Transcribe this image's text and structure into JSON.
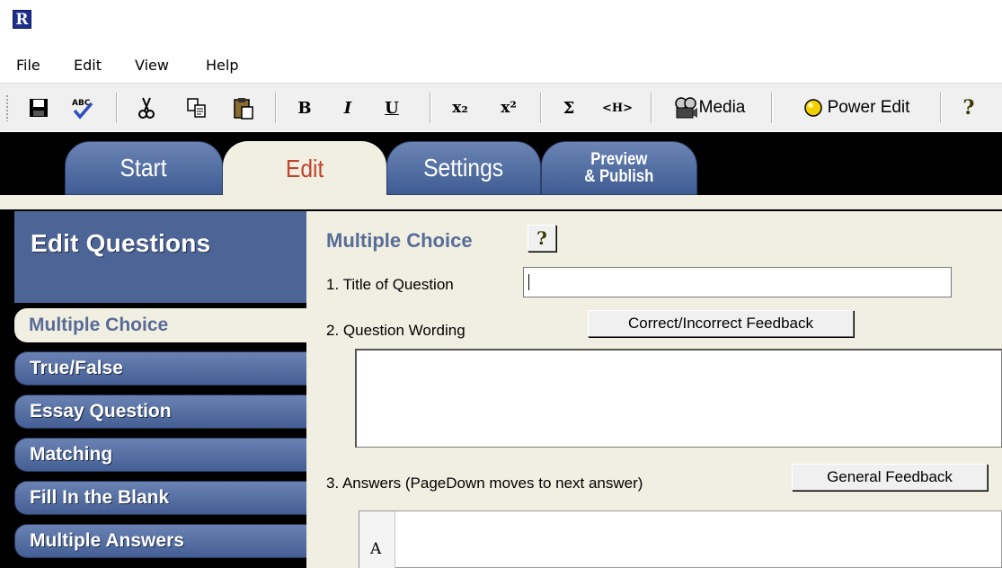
{
  "app": {
    "logo_letter": "R"
  },
  "menu": {
    "items": [
      "File",
      "Edit",
      "View",
      "Help"
    ]
  },
  "toolbar": {
    "bold": "B",
    "italic": "I",
    "underline": "U",
    "subscript": "x₂",
    "superscript": "x²",
    "sigma": "Σ",
    "html": "<H>",
    "media_label": "Media",
    "power_edit_label": "Power Edit",
    "help": "?"
  },
  "tabs": [
    {
      "label": "Start",
      "active": false
    },
    {
      "label": "Edit",
      "active": true
    },
    {
      "label": "Settings",
      "active": false
    },
    {
      "label_line1": "Preview",
      "label_line2": "& Publish",
      "active": false
    }
  ],
  "sidebar": {
    "title": "Edit Questions",
    "items": [
      {
        "label": "Multiple Choice",
        "active": true
      },
      {
        "label": "True/False",
        "active": false
      },
      {
        "label": "Essay Question",
        "active": false
      },
      {
        "label": "Matching",
        "active": false
      },
      {
        "label": "Fill In the Blank",
        "active": false
      },
      {
        "label": "Multiple Answers",
        "active": false
      }
    ]
  },
  "main": {
    "section_title": "Multiple Choice",
    "help_label": "?",
    "q1_label": "1.  Title of Question",
    "title_value": "",
    "q2_label": "2.  Question Wording",
    "feedback_button": "Correct/Incorrect Feedback",
    "q3_label": "3.  Answers  (PageDown moves to next answer)",
    "general_feedback_button": "General Feedback",
    "answer_letter": "A"
  },
  "colors": {
    "tab_blue": "#4d6496",
    "panel_bg": "#f1efe2",
    "active_tab_text": "#c0442a",
    "section_title": "#586c97"
  }
}
